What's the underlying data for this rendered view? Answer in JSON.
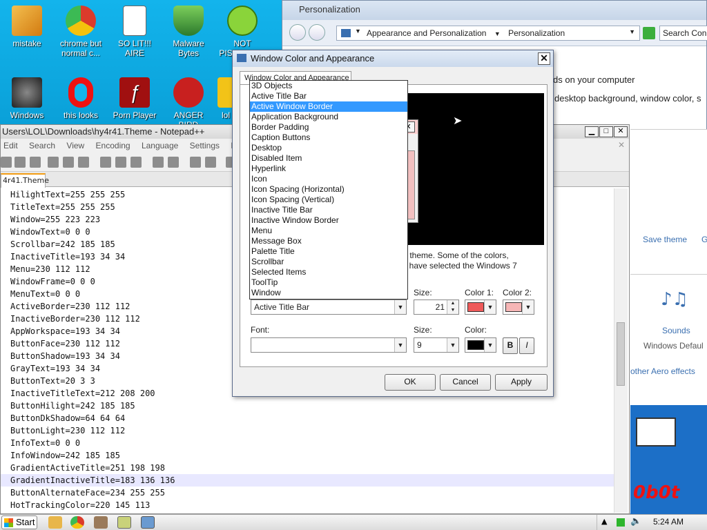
{
  "desktop": {
    "icons": [
      {
        "label": "mistake",
        "color": "#e8a020"
      },
      {
        "label": "chrome but normal c...",
        "color": "#db3b2b"
      },
      {
        "label": "SO LIT!!! AIRE",
        "color": "#f4f4f4"
      },
      {
        "label": "Malware Bytes",
        "color": "#4c9b3c"
      },
      {
        "label": "NOT PISSED BIR",
        "color": "#6abf2a"
      },
      {
        "label": "Windows",
        "color": "#3b8a3b"
      },
      {
        "label": "this looks",
        "color": "#d11"
      },
      {
        "label": "Porn Player",
        "color": "#a01010"
      },
      {
        "label": "ANGER BIRD",
        "color": "#c8201f"
      },
      {
        "label": "lol",
        "color": "#f2c318"
      }
    ]
  },
  "personalization": {
    "title": "Personalization",
    "breadcrumb": [
      "Appearance and Personalization",
      "Personalization"
    ],
    "search_placeholder": "Search Con",
    "text_line1": "ds on your computer",
    "text_line2": "desktop background, window color, s",
    "save_theme": "Save theme",
    "g_link": "G",
    "sounds_label": "Sounds",
    "sounds_value": "Windows Defaul",
    "aero_link": "other Aero effects",
    "brand_text": "0b0t"
  },
  "notepad": {
    "title": "Users\\LOL\\Downloads\\hy4r41.Theme - Notepad++",
    "menu": [
      "Edit",
      "Search",
      "View",
      "Encoding",
      "Language",
      "Settings",
      "M"
    ],
    "tab": "4r41.Theme",
    "lines": [
      "HilightText=255 255 255",
      "TitleText=255 255 255",
      "Window=255 223 223",
      "WindowText=0 0 0",
      "Scrollbar=242 185 185",
      "InactiveTitle=193 34 34",
      "Menu=230 112 112",
      "WindowFrame=0 0 0",
      "MenuText=0 0 0",
      "ActiveBorder=230 112 112",
      "InactiveBorder=230 112 112",
      "AppWorkspace=193 34 34",
      "ButtonFace=230 112 112",
      "ButtonShadow=193 34 34",
      "GrayText=193 34 34",
      "ButtonText=20 3 3",
      "InactiveTitleText=212 208 200",
      "ButtonHilight=242 185 185",
      "ButtonDkShadow=64 64 64",
      "ButtonLight=230 112 112",
      "InfoText=0 0 0",
      "InfoWindow=242 185 185",
      "GradientActiveTitle=251 198 198",
      "GradientInactiveTitle=183 136 136",
      "ButtonAlternateFace=234 255 255",
      "HotTrackingColor=220 145 113"
    ],
    "highlighted_line_index": 23
  },
  "dialog": {
    "title": "Window Color and Appearance",
    "tab": "Window Color and Appearance",
    "description_line1": "s 7 theme.  Some of the colors,",
    "description_line2": "ou have selected the Windows 7",
    "item_value": "Active Title Bar",
    "size_label": "Size:",
    "size_value": "21",
    "color1_label": "Color 1:",
    "color2_label": "Color 2:",
    "color1": "#ef5a5a",
    "color2": "#f6b6b6",
    "font_label": "Font:",
    "font_value": "",
    "font_size_label": "Size:",
    "font_size_value": "9",
    "font_color_label": "Color:",
    "font_color": "#000000",
    "bold_label": "B",
    "italic_label": "I",
    "ok_label": "OK",
    "cancel_label": "Cancel",
    "apply_label": "Apply"
  },
  "dropdown": {
    "items": [
      "3D Objects",
      "Active Title Bar",
      "Active Window Border",
      "Application Background",
      "Border Padding",
      "Caption Buttons",
      "Desktop",
      "Disabled Item",
      "Hyperlink",
      "Icon",
      "Icon Spacing (Horizontal)",
      "Icon Spacing (Vertical)",
      "Inactive Title Bar",
      "Inactive Window Border",
      "Menu",
      "Message Box",
      "Palette Title",
      "Scrollbar",
      "Selected Items",
      "ToolTip",
      "Window"
    ],
    "selected_index": 2
  },
  "taskbar": {
    "start_label": "Start",
    "clock": "5:24 AM"
  }
}
